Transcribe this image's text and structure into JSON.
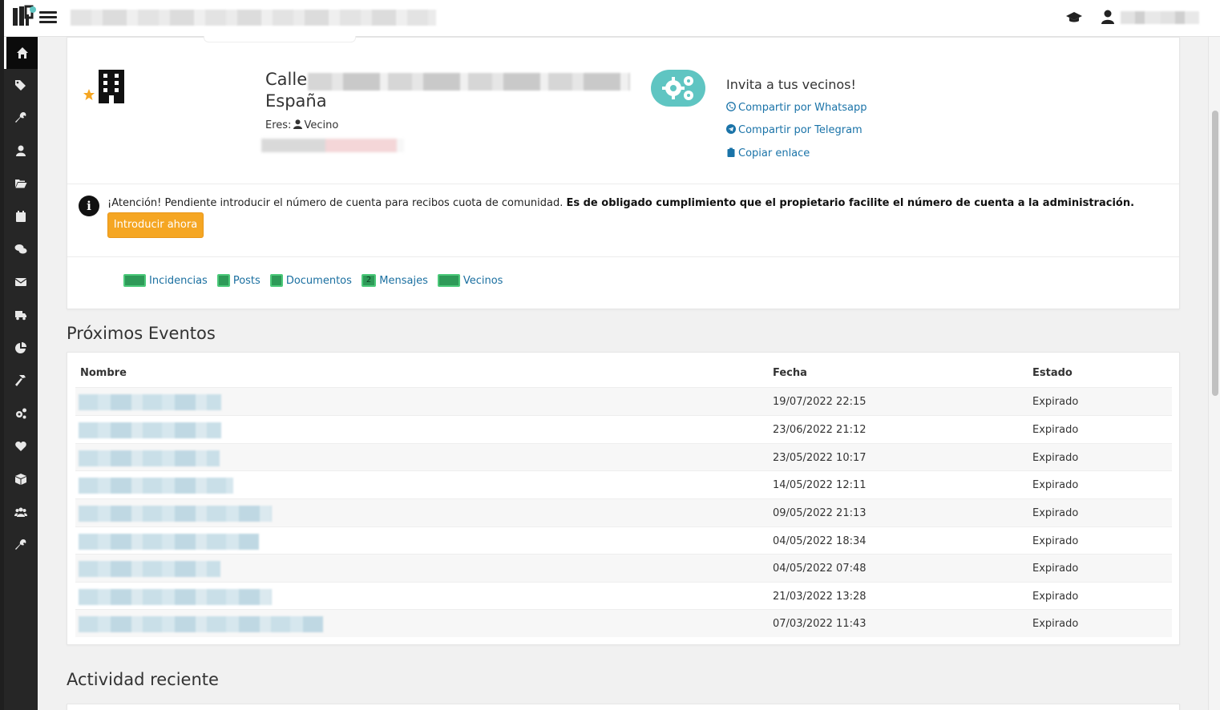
{
  "community": {
    "address_prefix": "Calle",
    "country": "España",
    "role_label": "Eres:",
    "role_value": "Vecino",
    "invite_title": "Invita a tus vecinos!",
    "share_whatsapp": "Compartir por Whatsapp",
    "share_telegram": "Compartir por Telegram",
    "copy_link": "Copiar enlace"
  },
  "alert": {
    "text_normal": "¡Atención! Pendiente introducir el número de cuenta para recibos cuota de comunidad. ",
    "text_bold": "Es de obligado cumplimiento que el propietario facilite el número de cuenta a la administración.",
    "button": "Introducir ahora"
  },
  "shortcuts": [
    {
      "label": "Incidencias",
      "badge": ""
    },
    {
      "label": "Posts",
      "badge": ""
    },
    {
      "label": "Documentos",
      "badge": ""
    },
    {
      "label": "Mensajes",
      "badge": "2"
    },
    {
      "label": "Vecinos",
      "badge": ""
    }
  ],
  "events": {
    "title": "Próximos Eventos",
    "columns": [
      "Nombre",
      "Fecha",
      "Estado"
    ],
    "rows": [
      {
        "fecha": "19/07/2022 22:15",
        "estado": "Expirado"
      },
      {
        "fecha": "23/06/2022 21:12",
        "estado": "Expirado"
      },
      {
        "fecha": "23/05/2022 10:17",
        "estado": "Expirado"
      },
      {
        "fecha": "14/05/2022 12:11",
        "estado": "Expirado"
      },
      {
        "fecha": "09/05/2022 21:13",
        "estado": "Expirado"
      },
      {
        "fecha": "04/05/2022 18:34",
        "estado": "Expirado"
      },
      {
        "fecha": "04/05/2022 07:48",
        "estado": "Expirado"
      },
      {
        "fecha": "21/03/2022 13:28",
        "estado": "Expirado"
      },
      {
        "fecha": "07/03/2022 11:43",
        "estado": "Expirado"
      }
    ]
  },
  "activity": {
    "title": "Actividad reciente"
  },
  "sidebar": {
    "icons": [
      "home-icon",
      "tags-icon",
      "wrench-icon",
      "user-icon",
      "folder-icon",
      "calendar-icon",
      "comments-icon",
      "envelope-icon",
      "truck-icon",
      "pie-chart-icon",
      "hammer-icon",
      "cogs-icon",
      "heart-icon",
      "box-icon",
      "users-icon",
      "tools-icon"
    ]
  },
  "colors": {
    "sidebar_bg": "#262626",
    "accent_teal": "#5fc5c2",
    "warning_button": "#f5a623",
    "link": "#1a73a8",
    "badge_green": "#2e9a58"
  }
}
